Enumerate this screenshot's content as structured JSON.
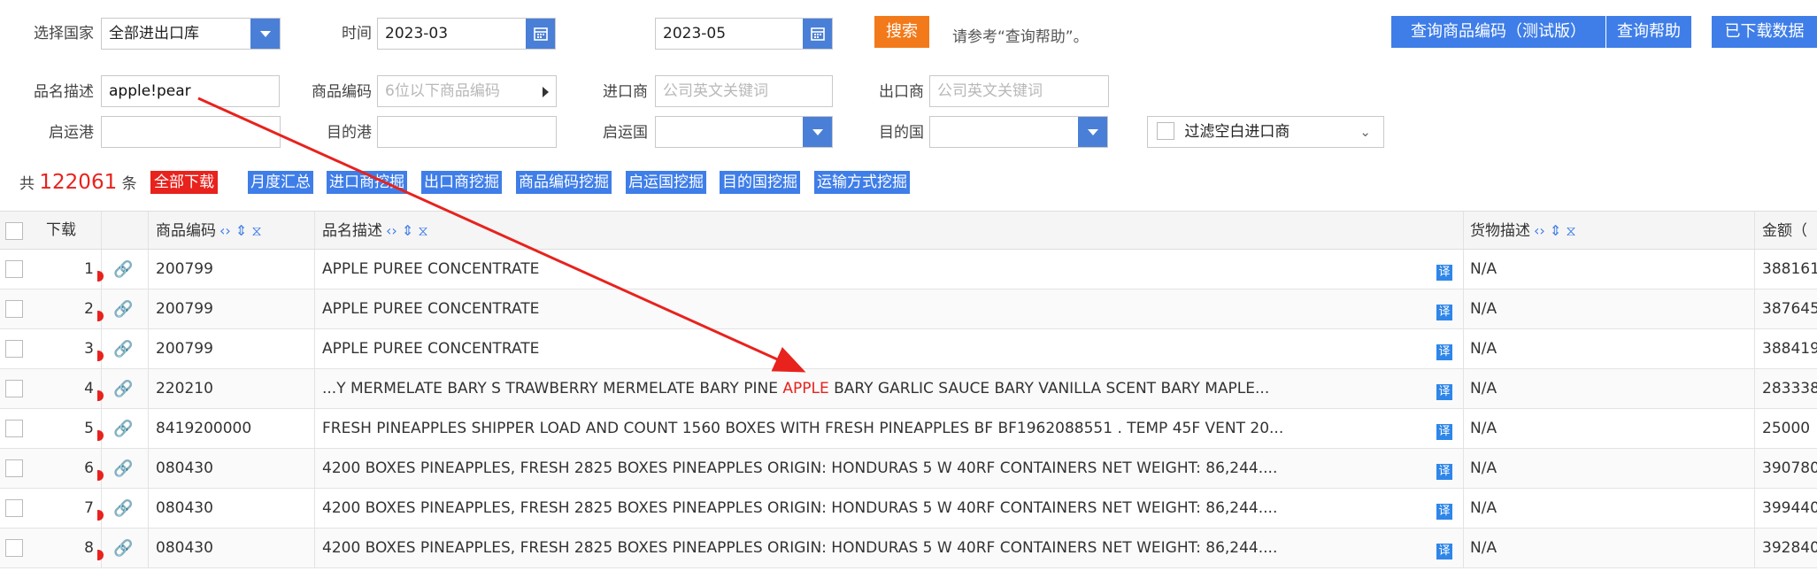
{
  "filters": {
    "country_label": "选择国家",
    "country_value": "全部进出口库",
    "time_label": "时间",
    "time_from": "2023-03",
    "time_to": "2023-05",
    "search_btn": "搜索",
    "help_hint": "请参考“查询帮助”。",
    "btn_code_lookup": "查询商品编码（测试版）",
    "btn_help": "查询帮助",
    "btn_downloaded": "已下载数据",
    "desc_label": "品名描述",
    "desc_value": "apple!pear",
    "code_label": "商品编码",
    "code_placeholder": "6位以下商品编码",
    "importer_label": "进口商",
    "importer_placeholder": "公司英文关键词",
    "exporter_label": "出口商",
    "exporter_placeholder": "公司英文关键词",
    "origin_port_label": "启运港",
    "dest_port_label": "目的港",
    "origin_country_label": "启运国",
    "dest_country_label": "目的国",
    "filter_blank_importer": "过滤空白进口商"
  },
  "summary": {
    "prefix": "共",
    "count": "122061",
    "suffix": "条",
    "download_all": "全部下载",
    "tags": [
      "月度汇总",
      "进口商挖掘",
      "出口商挖掘",
      "商品编码挖掘",
      "启运国挖掘",
      "目的国挖掘",
      "运输方式挖掘"
    ]
  },
  "table": {
    "headers": {
      "download": "下载",
      "code": "商品编码",
      "desc": "品名描述",
      "goods": "货物描述",
      "amount": "金额（"
    },
    "rows": [
      {
        "no": "1",
        "code": "200799",
        "desc_pre": "APPLE PUREE CONCENTRATE",
        "desc_hl": "",
        "desc_post": "",
        "goods": "N/A",
        "amount": "388161"
      },
      {
        "no": "2",
        "code": "200799",
        "desc_pre": "APPLE PUREE CONCENTRATE",
        "desc_hl": "",
        "desc_post": "",
        "goods": "N/A",
        "amount": "387645"
      },
      {
        "no": "3",
        "code": "200799",
        "desc_pre": "APPLE PUREE CONCENTRATE",
        "desc_hl": "",
        "desc_post": "",
        "goods": "N/A",
        "amount": "388419"
      },
      {
        "no": "4",
        "code": "220210",
        "desc_pre": "...Y MERMELATE BARY S TRAWBERRY MERMELATE BARY PINE ",
        "desc_hl": "APPLE",
        "desc_post": " BARY GARLIC SAUCE BARY VANILLA SCENT BARY MAPLE...",
        "goods": "N/A",
        "amount": "283338"
      },
      {
        "no": "5",
        "code": "8419200000",
        "desc_pre": "FRESH PINEAPPLES SHIPPER LOAD AND COUNT 1560 BOXES WITH FRESH PINEAPPLES BF BF1962088551 . TEMP 45F VENT 20...",
        "desc_hl": "",
        "desc_post": "",
        "goods": "N/A",
        "amount": "25000"
      },
      {
        "no": "6",
        "code": "080430",
        "desc_pre": "4200 BOXES PINEAPPLES, FRESH 2825 BOXES PINEAPPLES ORIGIN: HONDURAS 5 W 40RF CONTAINERS NET WEIGHT: 86,244....",
        "desc_hl": "",
        "desc_post": "",
        "goods": "N/A",
        "amount": "390780"
      },
      {
        "no": "7",
        "code": "080430",
        "desc_pre": "4200 BOXES PINEAPPLES, FRESH 2825 BOXES PINEAPPLES ORIGIN: HONDURAS 5 W 40RF CONTAINERS NET WEIGHT: 86,244....",
        "desc_hl": "",
        "desc_post": "",
        "goods": "N/A",
        "amount": "399440"
      },
      {
        "no": "8",
        "code": "080430",
        "desc_pre": "4200 BOXES PINEAPPLES, FRESH 2825 BOXES PINEAPPLES ORIGIN: HONDURAS 5 W 40RF CONTAINERS NET WEIGHT: 86,244....",
        "desc_hl": "",
        "desc_post": "",
        "goods": "N/A",
        "amount": "392840"
      }
    ],
    "translate_icon": "译"
  },
  "colors": {
    "accent_blue": "#3f7ee8",
    "search_orange": "#f27a1a",
    "highlight_red": "#e8221d",
    "arrow_red": "#e8221d"
  }
}
